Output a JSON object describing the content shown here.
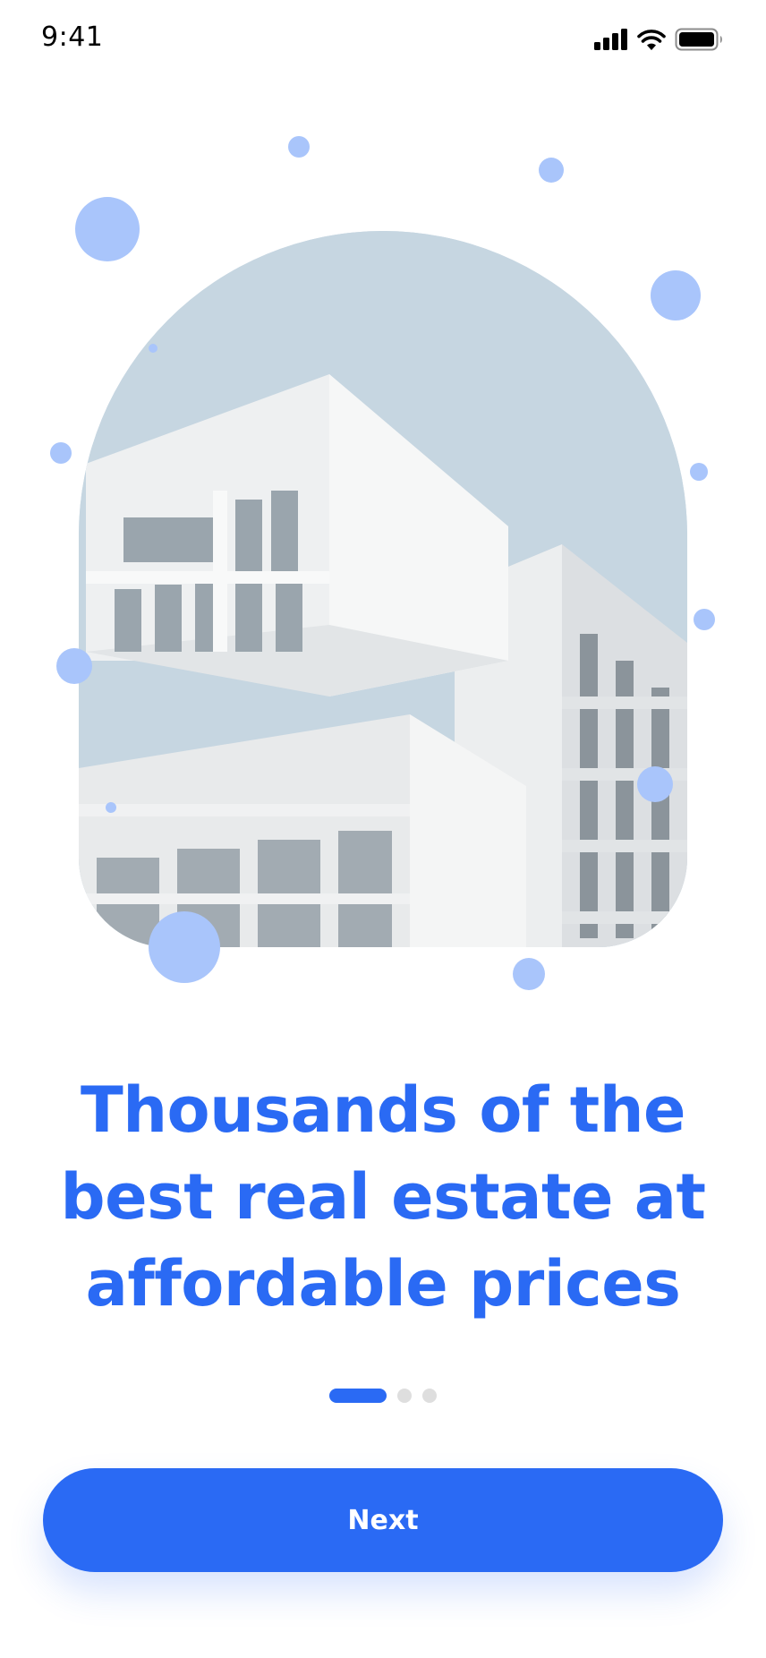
{
  "status_bar": {
    "time": "9:41",
    "icons": [
      "cellular-signal-icon",
      "wifi-icon",
      "battery-icon"
    ]
  },
  "hero": {
    "image": "modern-white-apartment-building",
    "accent_color": "#a9c5fb"
  },
  "onboarding": {
    "title": "Thousands of the best real estate at affordable prices",
    "page_indicator": {
      "total": 3,
      "active": 1
    }
  },
  "actions": {
    "next_label": "Next"
  },
  "colors": {
    "primary": "#2a6af4",
    "inactive_dot": "#dedede",
    "background": "#ffffff"
  }
}
